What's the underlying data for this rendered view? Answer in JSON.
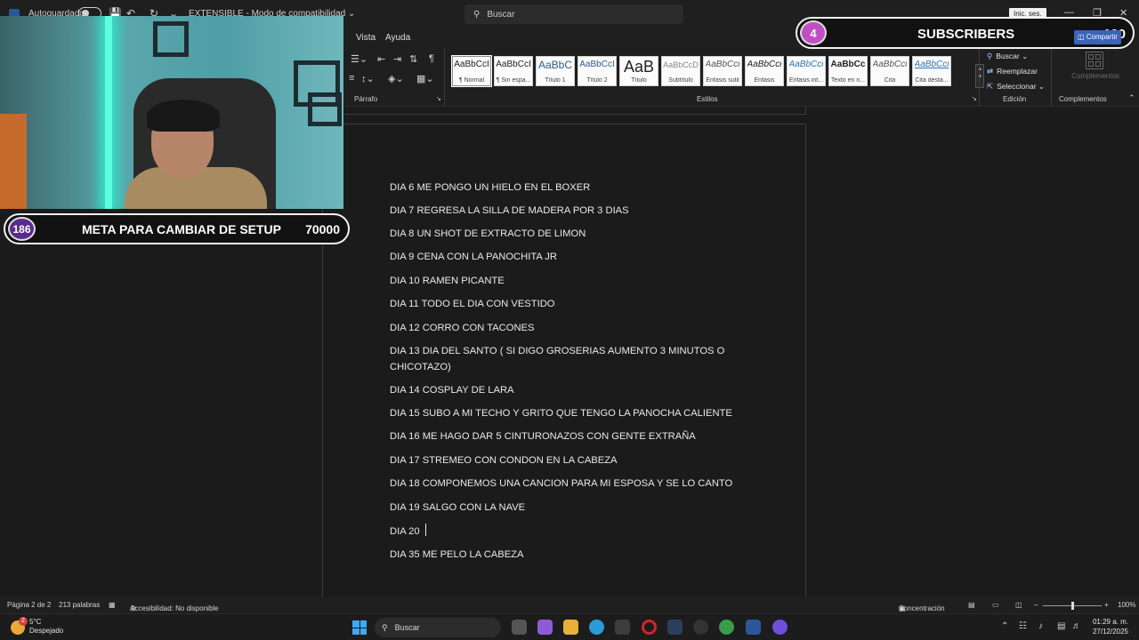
{
  "titlebar": {
    "autosave_label": "Autoguardado",
    "document_name": "EXTENSIBLE - Modo de compatibilidad ⌄",
    "search_placeholder": "Buscar",
    "login_label": "Inic. ses.",
    "share_label": "Compartir"
  },
  "menu": {
    "items": [
      "Vista",
      "Ayuda"
    ]
  },
  "ribbon": {
    "paragraph_group": "Párrafo",
    "styles_group": "Estilos",
    "styles": [
      {
        "preview": "AaBbCcI",
        "name": "¶ Normal"
      },
      {
        "preview": "AaBbCcI",
        "name": "¶ Sin espa..."
      },
      {
        "preview": "AaBbC",
        "name": "Título 1"
      },
      {
        "preview": "AaBbCcI",
        "name": "Título 2"
      },
      {
        "preview": "AaB",
        "name": "Título"
      },
      {
        "preview": "AaBbCcD",
        "name": "Subtítulo"
      },
      {
        "preview": "AaBbCci",
        "name": "Énfasis sutil"
      },
      {
        "preview": "AaBbCci",
        "name": "Énfasis"
      },
      {
        "preview": "AaBbCci",
        "name": "Énfasis int..."
      },
      {
        "preview": "AaBbCc",
        "name": "Texto en n..."
      },
      {
        "preview": "AaBbCci",
        "name": "Cita"
      },
      {
        "preview": "AaBbCci",
        "name": "Cita desta..."
      }
    ],
    "editing_group": "Edición",
    "find_label": "Buscar",
    "replace_label": "Reemplazar",
    "select_label": "Seleccionar",
    "addins_group": "Complementos",
    "addins_label": "Complementos"
  },
  "document": {
    "lines": [
      "DIA 6 ME PONGO UN HIELO EN EL BOXER",
      "DIA 7 REGRESA LA SILLA DE MADERA POR 3 DIAS",
      "DIA 8 UN SHOT DE EXTRACTO DE LIMON",
      "DIA 9 CENA CON LA PANOCHITA JR",
      "DIA 10 RAMEN PICANTE",
      "DIA 11 TODO EL DIA CON VESTIDO",
      "DIA 12 CORRO CON TACONES",
      "DIA 13 DIA DEL SANTO ( SI DIGO GROSERIAS AUMENTO 3 MINUTOS O CHICOTAZO)",
      "DIA 14 COSPLAY DE LARA",
      "DIA 15 SUBO A MI TECHO Y GRITO QUE TENGO LA PANOCHA CALIENTE",
      "DIA 16 ME HAGO DAR 5 CINTURONAZOS CON GENTE EXTRAÑA",
      "DIA 17 STREMEO CON CONDON EN LA CABEZA",
      "DIA 18 COMPONEMOS UNA CANCION PARA MI ESPOSA Y SE LO CANTO",
      "DIA 19 SALGO CON LA NAVE",
      "DIA 20",
      "DIA 35 ME PELO LA CABEZA"
    ]
  },
  "overlay": {
    "meta_count": "186",
    "meta_title": "META PARA CAMBIAR DE SETUP",
    "meta_goal": "70000",
    "subs_count": "4",
    "subs_title": "SUBSCRIBERS",
    "subs_goal": "100"
  },
  "statusbar": {
    "page": "Página 2 de 2",
    "words": "213 palabras",
    "accessibility": "Accesibilidad: No disponible",
    "focus": "Concentración",
    "zoom": "100%"
  },
  "taskbar": {
    "weather_badge": "2",
    "temperature": "5°C",
    "weather_desc": "Despejado",
    "search_label": "Buscar",
    "time": "01:29 a. m.",
    "date": "27/12/2025"
  },
  "colors": {
    "word_blue": "#2b579a",
    "meta_badge": "#5a2b8c",
    "subs_badge": "#c04fc3",
    "neon": "#5cffe0"
  }
}
